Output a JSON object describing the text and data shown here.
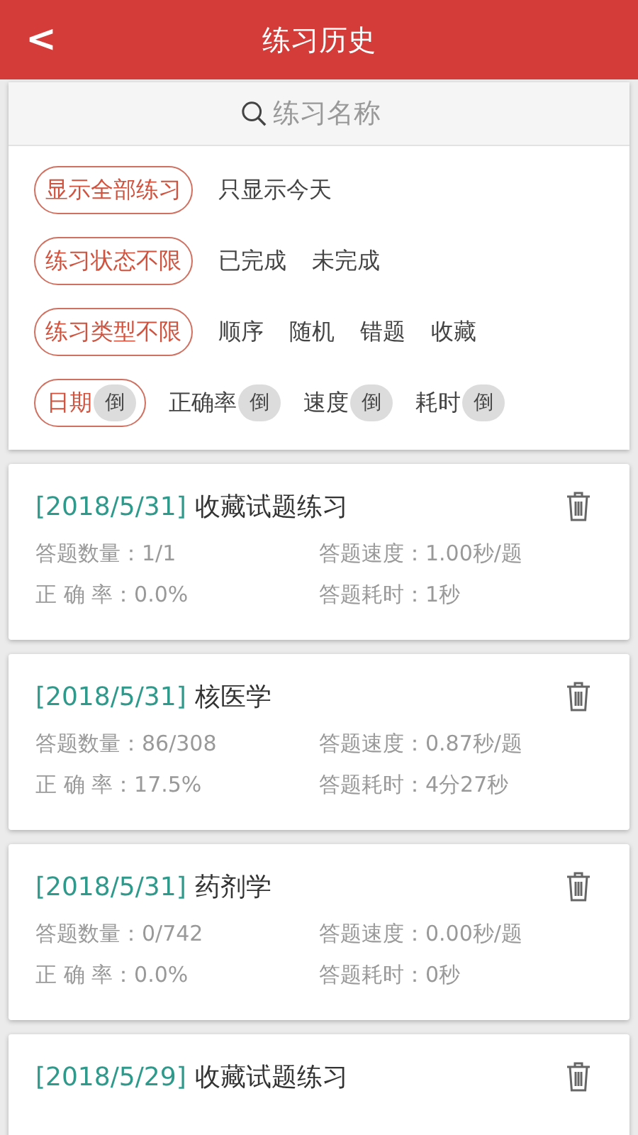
{
  "header": {
    "back": "<",
    "title": "练习历史"
  },
  "search": {
    "placeholder": "练习名称"
  },
  "filters": [
    {
      "options": [
        {
          "label": "显示全部练习",
          "selected": true
        },
        {
          "label": "只显示今天",
          "selected": false
        }
      ]
    },
    {
      "options": [
        {
          "label": "练习状态不限",
          "selected": true
        },
        {
          "label": "已完成",
          "selected": false
        },
        {
          "label": "未完成",
          "selected": false
        }
      ]
    },
    {
      "options": [
        {
          "label": "练习类型不限",
          "selected": true
        },
        {
          "label": "顺序",
          "selected": false
        },
        {
          "label": "随机",
          "selected": false
        },
        {
          "label": "错题",
          "selected": false
        },
        {
          "label": "收藏",
          "selected": false
        }
      ]
    }
  ],
  "sort": [
    {
      "label": "日期",
      "badge": "倒",
      "selected": true
    },
    {
      "label": "正确率",
      "badge": "倒",
      "selected": false
    },
    {
      "label": "速度",
      "badge": "倒",
      "selected": false
    },
    {
      "label": "耗时",
      "badge": "倒",
      "selected": false
    }
  ],
  "records": [
    {
      "date": "[2018/5/31]",
      "name": "收藏试题练习",
      "stats": [
        "答题数量：1/1",
        "答题速度：1.00秒/题",
        "正 确 率：0.0%",
        "答题耗时：1秒"
      ]
    },
    {
      "date": "[2018/5/31]",
      "name": "核医学",
      "stats": [
        "答题数量：86/308",
        "答题速度：0.87秒/题",
        "正 确 率：17.5%",
        "答题耗时：4分27秒"
      ]
    },
    {
      "date": "[2018/5/31]",
      "name": "药剂学",
      "stats": [
        "答题数量：0/742",
        "答题速度：0.00秒/题",
        "正 确 率：0.0%",
        "答题耗时：0秒"
      ]
    },
    {
      "date": "[2018/5/29]",
      "name": "收藏试题练习"
    }
  ]
}
